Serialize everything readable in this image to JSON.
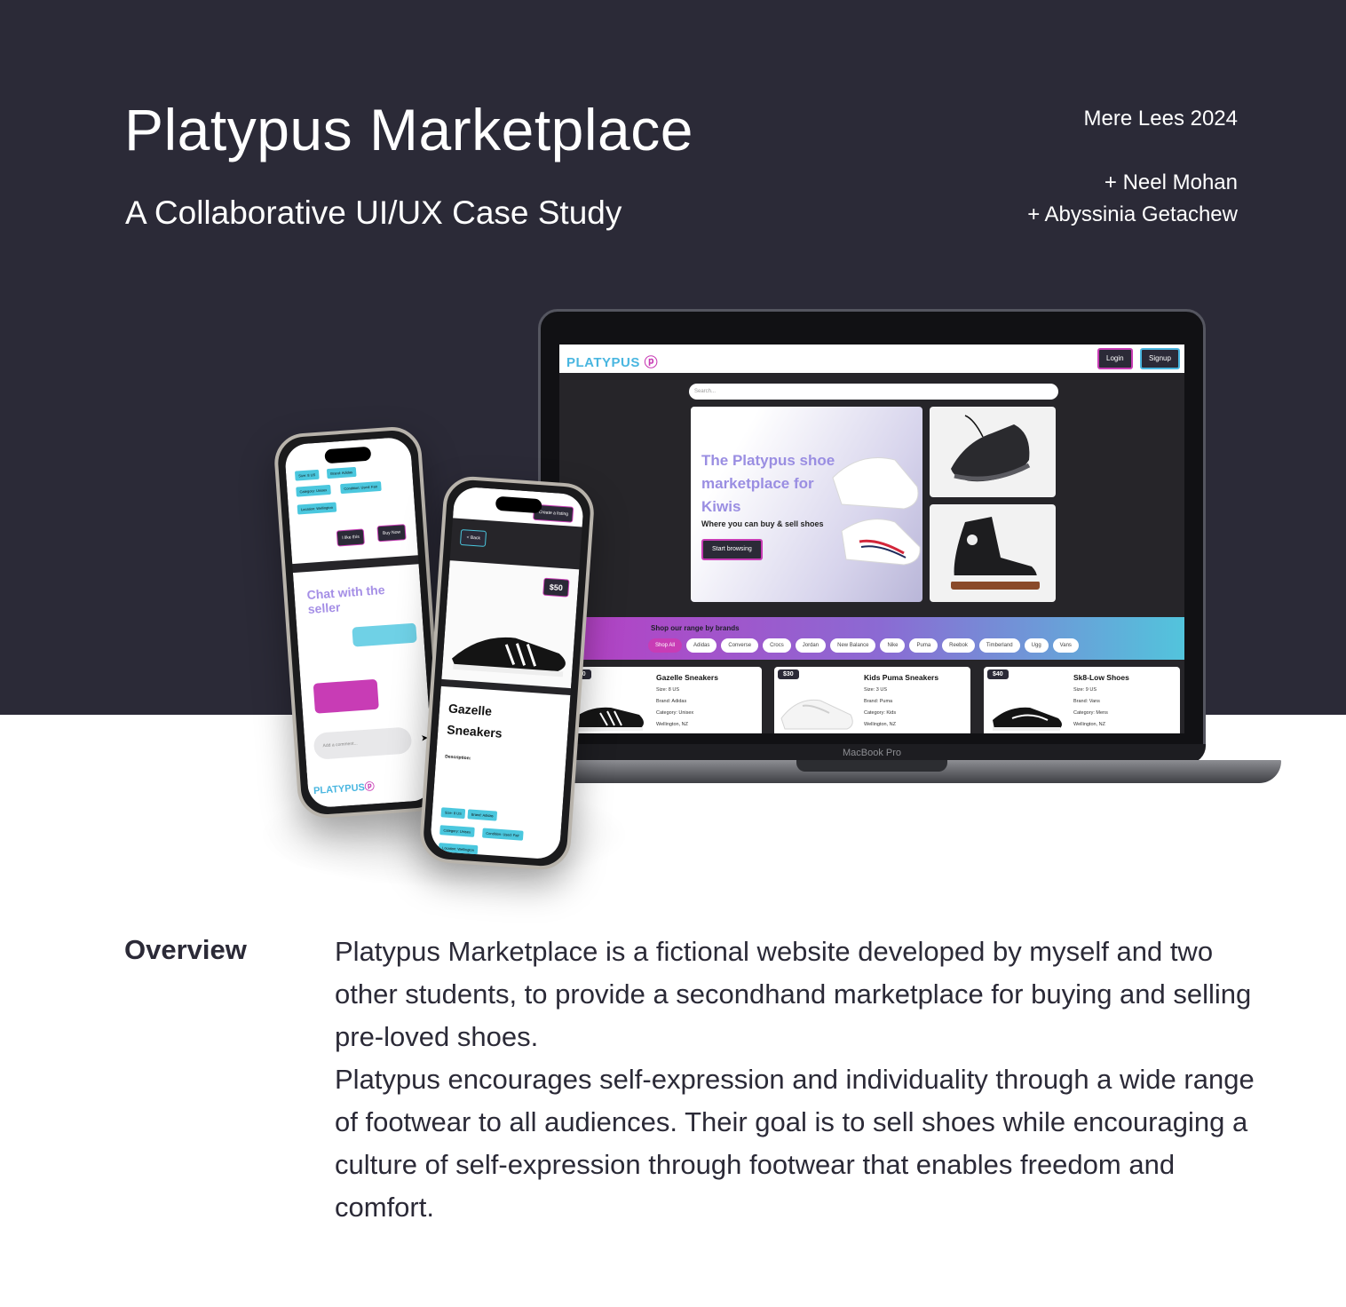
{
  "header": {
    "title": "Platypus Marketplace",
    "subtitle": "A Collaborative UI/UX Case Study",
    "author": "Mere Lees 2024",
    "collaborators": [
      "+ Neel Mohan",
      "+  Abyssinia Getachew"
    ]
  },
  "laptop": {
    "device_label": "MacBook Pro",
    "site": {
      "logo": "PLATYPUS",
      "login_label": "Login",
      "signup_label": "Signup",
      "search_placeholder": "Search...",
      "hero_heading": "The Platypus shoe marketplace for Kiwis",
      "hero_sub": "Where you can buy & sell shoes",
      "hero_button": "Start browsing",
      "brands_title": "Shop our range by brands",
      "brands": [
        "Shop All",
        "Adidas",
        "Converse",
        "Crocs",
        "Jordan",
        "New Balance",
        "Nike",
        "Puma",
        "Reebok",
        "Timberland",
        "Ugg",
        "Vans"
      ],
      "products": [
        {
          "price": "$50",
          "name": "Gazelle Sneakers",
          "size": "Size: 8 US",
          "brand": "Brand: Adidas",
          "category": "Category: Unisex",
          "location": "Wellington, NZ"
        },
        {
          "price": "$30",
          "name": "Kids Puma Sneakers",
          "size": "Size: 3 US",
          "brand": "Brand: Puma",
          "category": "Category: Kids",
          "location": "Wellington, NZ"
        },
        {
          "price": "$40",
          "name": "Sk8-Low Shoes",
          "size": "Size: 9 US",
          "brand": "Brand: Vans",
          "category": "Category: Mens",
          "location": "Wellington, NZ"
        }
      ]
    }
  },
  "phone_chat": {
    "tags": [
      "Size: 8 US",
      "Brand: Adidas",
      "Category: Unisex",
      "Condition: Used: Fair",
      "Location: Wellington"
    ],
    "like_button": "I like this",
    "buy_button": "Buy Now",
    "chat_title": "Chat with the seller",
    "input_placeholder": "Add a comment...",
    "send_icon": "send-icon",
    "footer_logo": "PLATYPUS"
  },
  "phone_listing": {
    "create_button": "Create a listing",
    "back_button": "< Back",
    "price": "$50",
    "product_name": "Gazelle Sneakers",
    "description_label": "Description:",
    "tags": [
      "Size: 8 US",
      "Brand: Adidas",
      "Category: Unisex",
      "Condition: Used: Fair",
      "Location: Wellington"
    ]
  },
  "overview": {
    "label": "Overview",
    "paragraph_1": "Platypus Marketplace is a fictional website developed by myself and two other students, to provide a secondhand marketplace for buying and selling pre-loved shoes.",
    "paragraph_2": "Platypus encourages self-expression and individuality through a wide range of footwear to all audiences. Their goal is to sell shoes while encouraging a culture of self-expression  through footwear that enables freedom and comfort."
  },
  "colors": {
    "dark_bg": "#2b2a37",
    "accent_pink": "#c83cb5",
    "accent_blue": "#49b6e0",
    "text": "#2b2a37"
  }
}
